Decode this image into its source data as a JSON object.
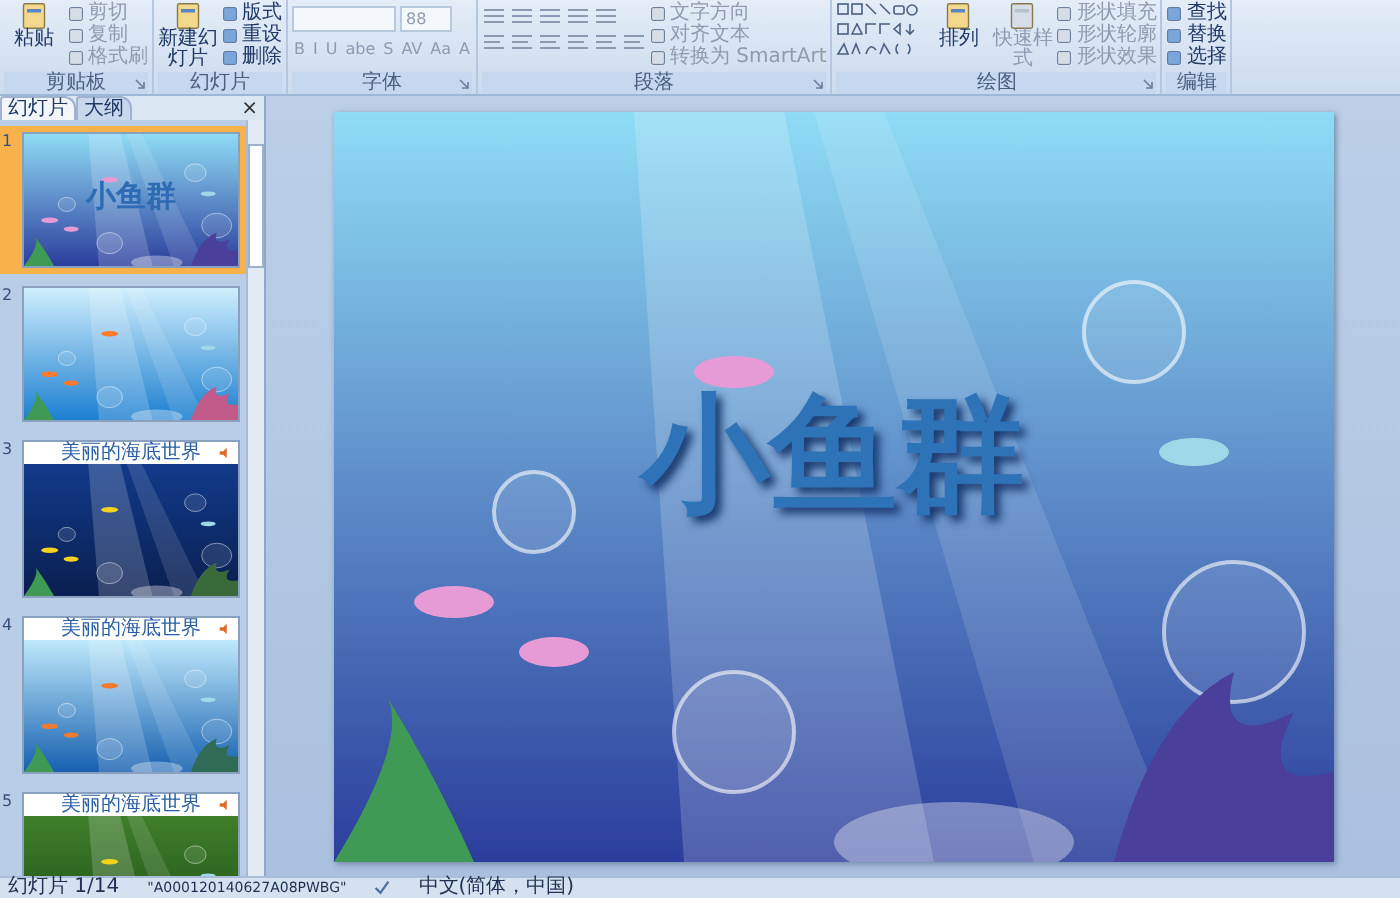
{
  "ribbon": {
    "groups": [
      {
        "kind": "buttons",
        "label": "剪贴板",
        "launcher": true,
        "large": [
          {
            "label": "粘贴",
            "disabled": false
          }
        ],
        "small": [
          {
            "label": "剪切",
            "disabled": true
          },
          {
            "label": "复制",
            "disabled": true
          },
          {
            "label": "格式刷",
            "disabled": true
          }
        ]
      },
      {
        "kind": "buttons",
        "label": "幻灯片",
        "launcher": false,
        "large": [
          {
            "label": "新建幻灯片",
            "disabled": false
          }
        ],
        "small": [
          {
            "label": "版式",
            "disabled": false
          },
          {
            "label": "重设",
            "disabled": false
          },
          {
            "label": "删除",
            "disabled": false
          }
        ]
      },
      {
        "kind": "font",
        "label": "字体",
        "launcher": true,
        "size_field": {
          "value": "88"
        },
        "tools": [
          "B",
          "I",
          "U",
          "abe",
          "S",
          "AV",
          "Aa",
          "A"
        ]
      },
      {
        "kind": "paragraph",
        "label": "段落",
        "launcher": true,
        "small": [
          {
            "label": "文字方向",
            "disabled": true
          },
          {
            "label": "对齐文本",
            "disabled": true
          },
          {
            "label": "转换为 SmartArt",
            "disabled": true
          }
        ]
      },
      {
        "kind": "drawing",
        "label": "绘图",
        "launcher": true,
        "large": [
          {
            "label": "排列",
            "disabled": false
          },
          {
            "label": "快速样式",
            "disabled": true
          }
        ],
        "small": [
          {
            "label": "形状填充",
            "disabled": true
          },
          {
            "label": "形状轮廓",
            "disabled": true
          },
          {
            "label": "形状效果",
            "disabled": true
          }
        ]
      },
      {
        "kind": "buttons",
        "label": "编辑",
        "launcher": false,
        "small": [
          {
            "label": "查找",
            "disabled": false
          },
          {
            "label": "替换",
            "disabled": false
          },
          {
            "label": "选择",
            "disabled": false
          }
        ]
      }
    ]
  },
  "panel": {
    "tabs": [
      {
        "label": "幻灯片",
        "selected": true
      },
      {
        "label": "大纲",
        "selected": false
      }
    ],
    "close": "×",
    "slides": [
      {
        "number": "1",
        "selected": true,
        "title": "小鱼群"
      },
      {
        "number": "2",
        "selected": false
      },
      {
        "number": "3",
        "selected": false,
        "header": "美丽的海底世界"
      },
      {
        "number": "4",
        "selected": false,
        "header": "美丽的海底世界"
      },
      {
        "number": "5",
        "selected": false,
        "header": "美丽的海底世界"
      }
    ]
  },
  "slide": {
    "title": "小鱼群"
  },
  "status_bar": {
    "slide": "幻灯片 1/14",
    "theme": "\"A000120140627A08PWBG\"",
    "language": "中文(简体，中国)"
  }
}
